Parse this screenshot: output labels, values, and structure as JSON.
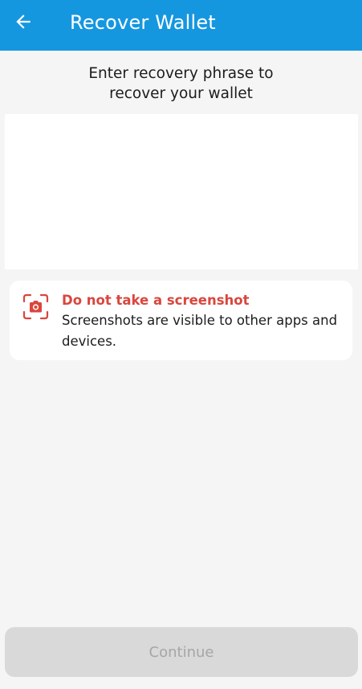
{
  "app_bar": {
    "title": "Recover Wallet",
    "back_icon": "arrow-left-icon",
    "background_color": "#1597e0"
  },
  "prompt": {
    "line1": "Enter recovery phrase to",
    "line2": "recover your wallet"
  },
  "phrase_input": {
    "value": "",
    "placeholder": ""
  },
  "warning": {
    "icon": "camera-icon",
    "title": "Do not take a screenshot",
    "body": "Screenshots are visible to other apps and devices.",
    "accent_color": "#d9463e"
  },
  "continue_button": {
    "label": "Continue",
    "state": "disabled"
  }
}
